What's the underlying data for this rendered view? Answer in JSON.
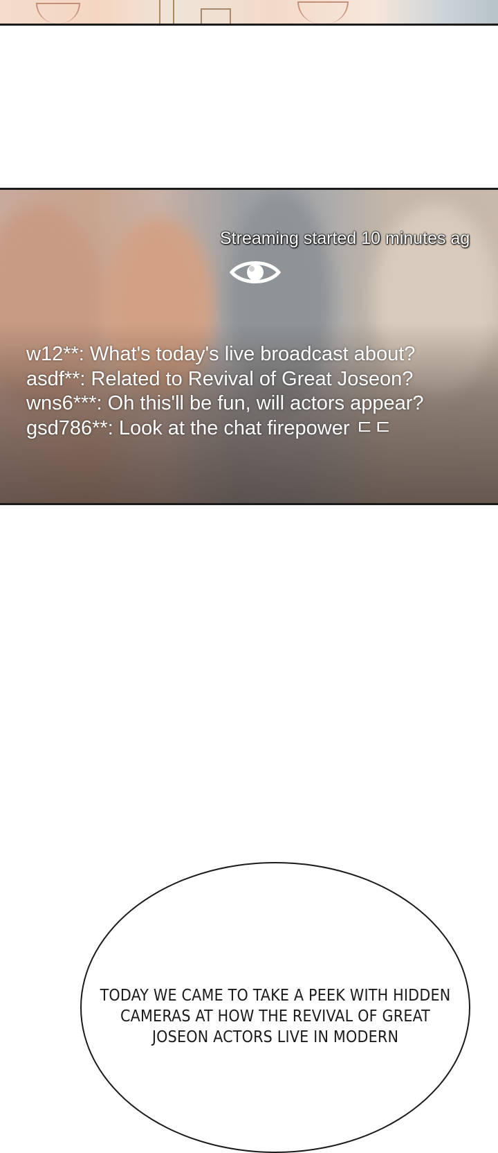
{
  "stream": {
    "status": "Streaming started 10 minutes ag",
    "chat_log": "w12**: What's today's live broadcast about? asdf**: Related to Revival of Great Joseon? wns6***: Oh this'll be fun, will actors appear? gsd786**: Look at the chat firepower ㄷㄷ"
  },
  "speech_bubble": {
    "text": "TODAY WE CAME TO TAKE A PEEK WITH HIDDEN CAMERAS AT HOW THE REVIVAL OF GREAT JOSEON ACTORS LIVE IN MODERN"
  },
  "icons": {
    "view": "eye-icon"
  }
}
